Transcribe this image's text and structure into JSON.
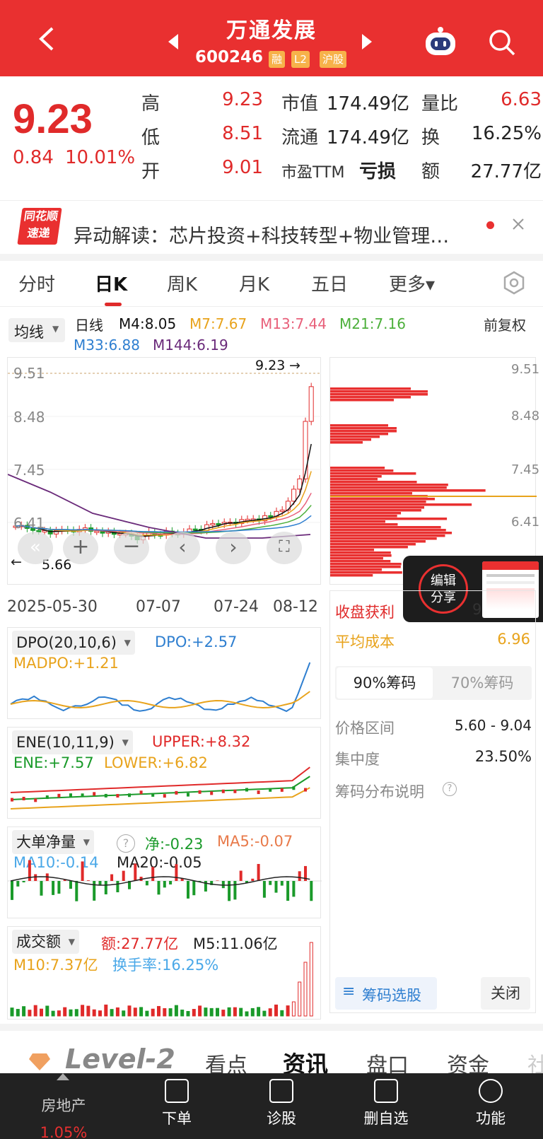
{
  "header": {
    "title": "万通发展",
    "code": "600246",
    "tags": [
      "融",
      "L2",
      "沪股"
    ]
  },
  "quote": {
    "price": "9.23",
    "change": "0.84",
    "change_pct": "10.01%",
    "rows": [
      {
        "l1": "高",
        "v1": "9.23",
        "l2": "市值",
        "v2": "174.49亿",
        "l3": "量比",
        "v3": "6.63"
      },
      {
        "l1": "低",
        "v1": "8.51",
        "l2": "流通",
        "v2": "174.49亿",
        "l3": "换",
        "v3": "16.25%"
      },
      {
        "l1": "开",
        "v1": "9.01",
        "l2": "市盈TTM",
        "v2": "亏损",
        "l3": "额",
        "v3": "27.77亿"
      }
    ]
  },
  "news": {
    "logo_top": "同花顺",
    "logo_bottom": "速递",
    "text": "异动解读：芯片投资+科技转型+物业管理…"
  },
  "tabs": [
    "分时",
    "日K",
    "周K",
    "月K",
    "五日",
    "更多▾"
  ],
  "ma": {
    "selector": "均线",
    "period": "日线",
    "m4": "M4:8.05",
    "m7": "M7:7.67",
    "m13": "M13:7.44",
    "m21": "M21:7.16",
    "m33": "M33:6.88",
    "m144": "M144:6.19",
    "adjust": "前复权"
  },
  "kline": {
    "y_ticks": [
      "9.51",
      "8.48",
      "7.45",
      "6.41"
    ],
    "high_label": "9.23",
    "low_label": "5.66",
    "dates": [
      "2025-05-30",
      "07-07",
      "07-24",
      "08-12"
    ]
  },
  "chips": {
    "y_ticks": [
      "9.51",
      "8.48",
      "7.45",
      "6.41"
    ],
    "profit_label": "收盘获利",
    "avg_cost_label": "平均成本",
    "avg_cost": "6.96",
    "tab90": "90%筹码",
    "tab70": "70%筹码",
    "range_label": "价格区间",
    "range_val": "5.60 - 9.04",
    "conc_label": "集中度",
    "conc_val": "23.50%",
    "help": "筹码分布说明",
    "select_btn": "筹码选股",
    "close_btn": "关闭"
  },
  "share_popup": {
    "label1": "编辑",
    "label2": "分享",
    "behind": "9"
  },
  "dpo": {
    "name": "DPO(20,10,6)",
    "dpo": "DPO:+2.57",
    "madpo": "MADPO:+1.21"
  },
  "ene": {
    "name": "ENE(10,11,9)",
    "upper": "UPPER:+8.32",
    "ene": "ENE:+7.57",
    "lower": "LOWER:+6.82"
  },
  "big": {
    "name": "大单净量",
    "net": "净:-0.23",
    "ma5": "MA5:-0.07",
    "ma10": "MA10:-0.14",
    "ma20": "MA20:-0.05"
  },
  "amount": {
    "name": "成交额",
    "amt": "额:27.77亿",
    "m5": "M5:11.06亿",
    "m10": "M10:7.37亿",
    "turn": "换手率:16.25%"
  },
  "bottom_tabs": [
    "Level-2",
    "看点",
    "资讯",
    "盘口",
    "资金",
    "社"
  ],
  "bottom_nav": {
    "sector": "房地产",
    "sector_chg": "1.05%",
    "items": [
      "下单",
      "诊股",
      "删自选",
      "功能"
    ]
  },
  "colors": {
    "red": "#e93030",
    "green": "#1a9a2a",
    "blue": "#2f7fd0",
    "yellow": "#e8a31c"
  }
}
